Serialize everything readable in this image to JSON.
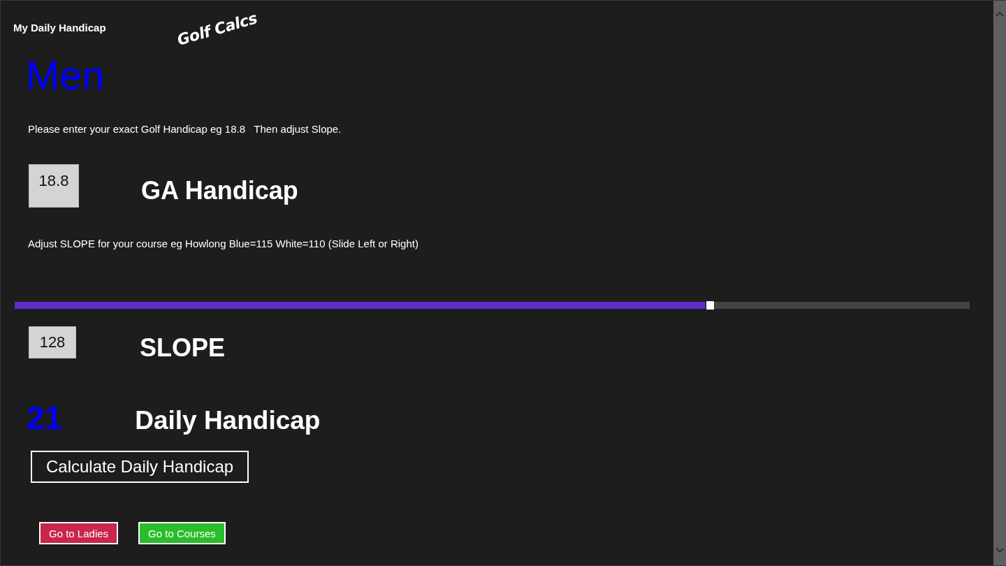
{
  "app": {
    "title": "My Daily Handicap",
    "logo": "Golf Calcs"
  },
  "heading": "Men",
  "handicap": {
    "instruction": "Please enter your exact Golf Handicap eg 18.8   Then adjust Slope.",
    "value": "18.8",
    "label": "GA Handicap"
  },
  "slope": {
    "instruction": "Adjust SLOPE for your course eg Howlong Blue=115 White=110 (Slide Left or Right)",
    "level": 0.728,
    "value": "128",
    "label": "SLOPE"
  },
  "result": {
    "value": "21",
    "label": "Daily Handicap"
  },
  "calculate_button": "Calculate Daily Handicap",
  "nav_buttons": [
    {
      "label": "Go to Ladies",
      "color": "#c8264a"
    },
    {
      "label": "Go to Courses",
      "color": "#29bd29"
    }
  ]
}
